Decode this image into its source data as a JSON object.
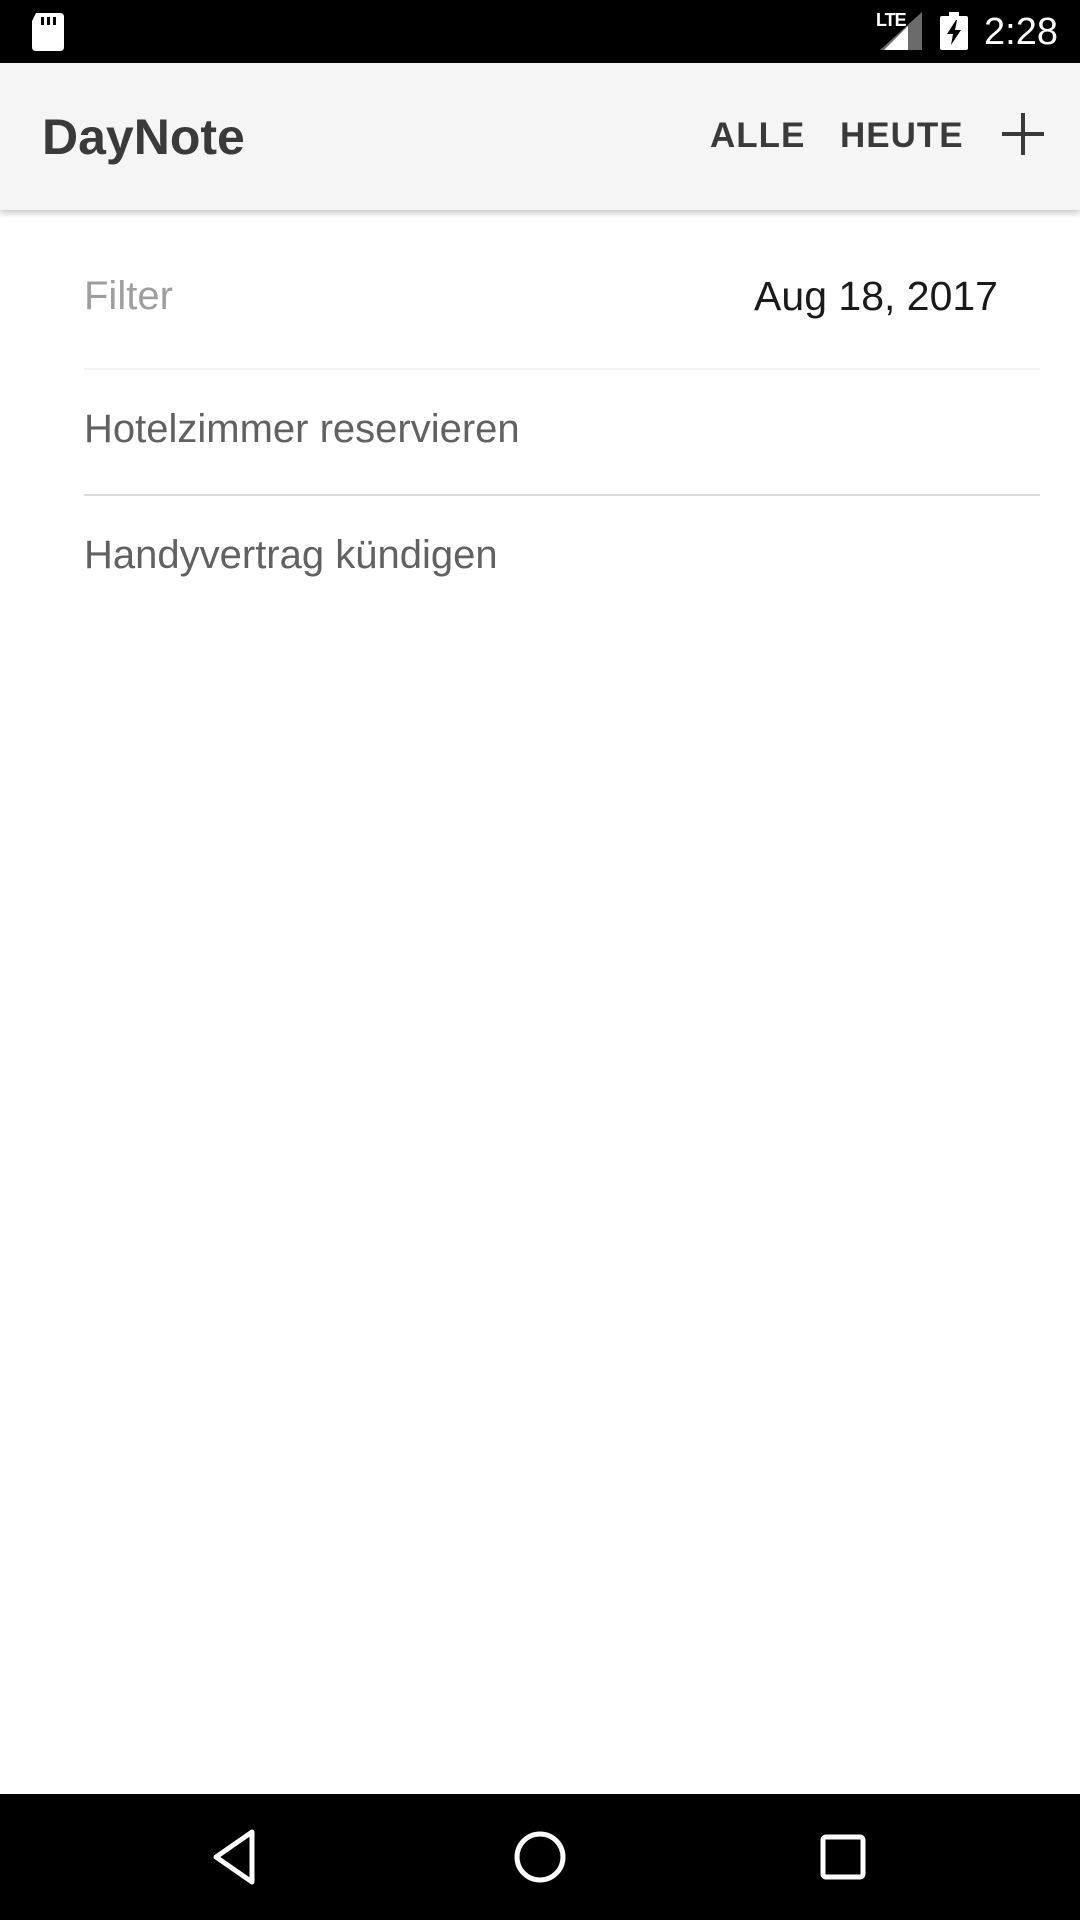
{
  "status_bar": {
    "network_label": "LTE",
    "time": "2:28",
    "icons": [
      "sd-card-icon",
      "signal-icon",
      "battery-charging-icon"
    ]
  },
  "app_bar": {
    "title": "DayNote",
    "actions": {
      "all_label": "ALLE",
      "today_label": "HEUTE"
    },
    "add_icon": "plus-icon"
  },
  "filter": {
    "placeholder": "Filter",
    "value": "",
    "date": "Aug 18, 2017"
  },
  "notes": [
    {
      "text": "Hotelzimmer reservieren"
    },
    {
      "text": "Handyvertrag kündigen"
    }
  ],
  "nav_bar": {
    "icons": [
      "back-icon",
      "home-icon",
      "recents-icon"
    ]
  },
  "colors": {
    "app_bar_bg": "#f5f5f5",
    "title_text": "#3a3a3a",
    "item_text": "#616161",
    "placeholder_text": "#9e9e9e",
    "system_bars": "#000000"
  }
}
